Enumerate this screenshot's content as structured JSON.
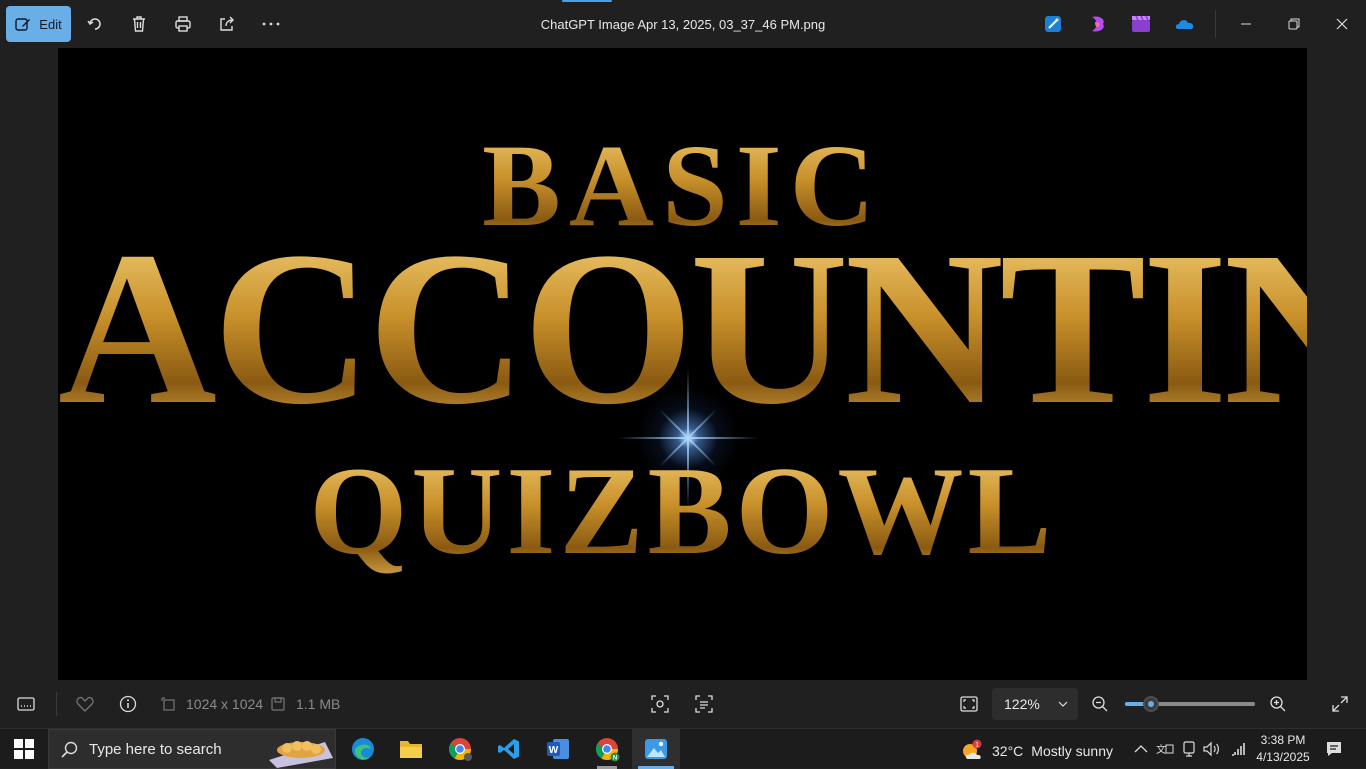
{
  "titlebar": {
    "edit_label": "Edit",
    "file_name": "ChatGPT Image Apr 13, 2025, 03_37_46 PM.png"
  },
  "image": {
    "line1": "BASIC",
    "line2": "ACCOUNTING",
    "line3": "QUIZBOWL"
  },
  "bottombar": {
    "dimensions": "1024 x 1024",
    "file_size": "1.1 MB",
    "zoom": "122%",
    "zoom_slider_fraction": 0.2
  },
  "taskbar": {
    "search_placeholder": "Type here to search",
    "weather_temp": "32°C",
    "weather_desc": "Mostly sunny",
    "weather_badge": "1",
    "time": "3:38 PM",
    "date": "4/13/2025"
  },
  "colors": {
    "accent": "#6aaee8",
    "gold": "#c9962a"
  }
}
